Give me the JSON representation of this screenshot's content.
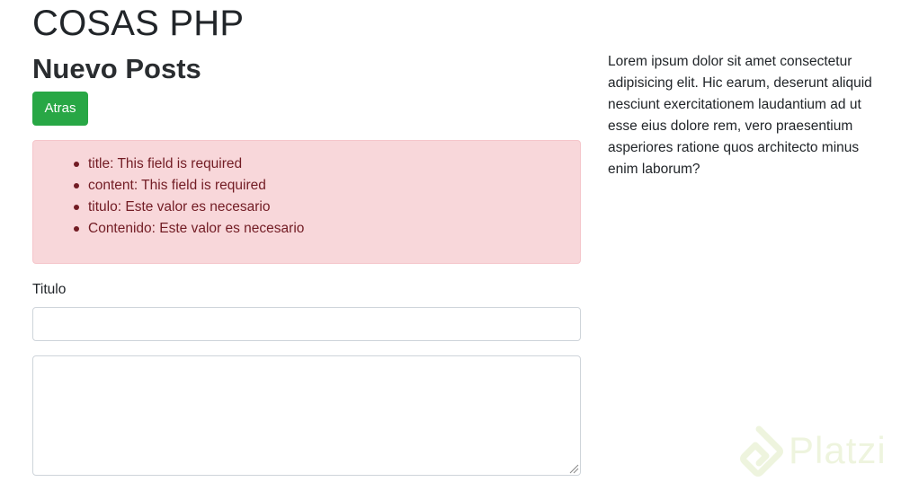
{
  "header": {
    "site_title": "COSAS PHP",
    "page_heading": "Nuevo Posts"
  },
  "actions": {
    "back_label": "Atras",
    "back_color": "#28a745"
  },
  "alert": {
    "type": "danger",
    "background": "#f8d7da",
    "text_color": "#721c24",
    "errors": [
      "title: This field is required",
      "content: This field is required",
      "titulo: Este valor es necesario",
      "Contenido: Este valor es necesario"
    ]
  },
  "form": {
    "title_label": "Titulo",
    "title_value": "",
    "content_value": ""
  },
  "sidebar": {
    "text": "Lorem ipsum dolor sit amet consectetur adipisicing elit. Hic earum, deserunt aliquid nesciunt exercitationem laudantium ad ut esse eius dolore rem, vero praesentium asperiores ratione quos architecto minus enim laborum?"
  },
  "watermark": {
    "text": "Platzi",
    "icon": "platzi-logo-icon"
  }
}
